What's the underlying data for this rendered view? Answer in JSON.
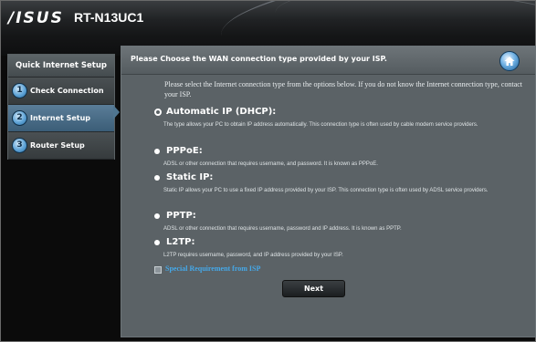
{
  "header": {
    "brand": "/ISUS",
    "model": "RT-N13UC1"
  },
  "sidebar": {
    "title": "Quick Internet Setup",
    "steps": [
      {
        "num": "1",
        "label": "Check Connection"
      },
      {
        "num": "2",
        "label": "Internet Setup",
        "active": true
      },
      {
        "num": "3",
        "label": "Router Setup"
      }
    ]
  },
  "main": {
    "title": "Please Choose the WAN connection type provided by your ISP.",
    "intro": "Please select the Internet connection type from the options below. If you do not know the Internet connection type, contact your ISP.",
    "options": [
      {
        "name": "Automatic IP (DHCP):",
        "desc": "The type allows your PC to obtain IP address automatically. This connection type is often used by cable modem service providers.",
        "selected": true
      },
      {
        "name": "PPPoE:",
        "desc": "ADSL or other connection that requires username, and password. It is known as PPPoE.",
        "selected": false
      },
      {
        "name": "Static IP:",
        "desc": "Static IP allows your PC to use a fixed IP address provided by your ISP. This connection type is often used by ADSL service providers.",
        "selected": false
      },
      {
        "name": "PPTP:",
        "desc": "ADSL or other connection that requires username, password and IP address. It is known as PPTP.",
        "selected": false
      },
      {
        "name": "L2TP:",
        "desc": "L2TP requires username, password, and IP address provided by your ISP.",
        "selected": false
      }
    ],
    "special_requirement": "Special Requirement from ISP",
    "next_label": "Next"
  },
  "icons": {
    "home": "home-icon"
  },
  "colors": {
    "accent_link": "#45a8e8",
    "panel_bg": "#5b6266",
    "active_step": "#4f7590"
  }
}
